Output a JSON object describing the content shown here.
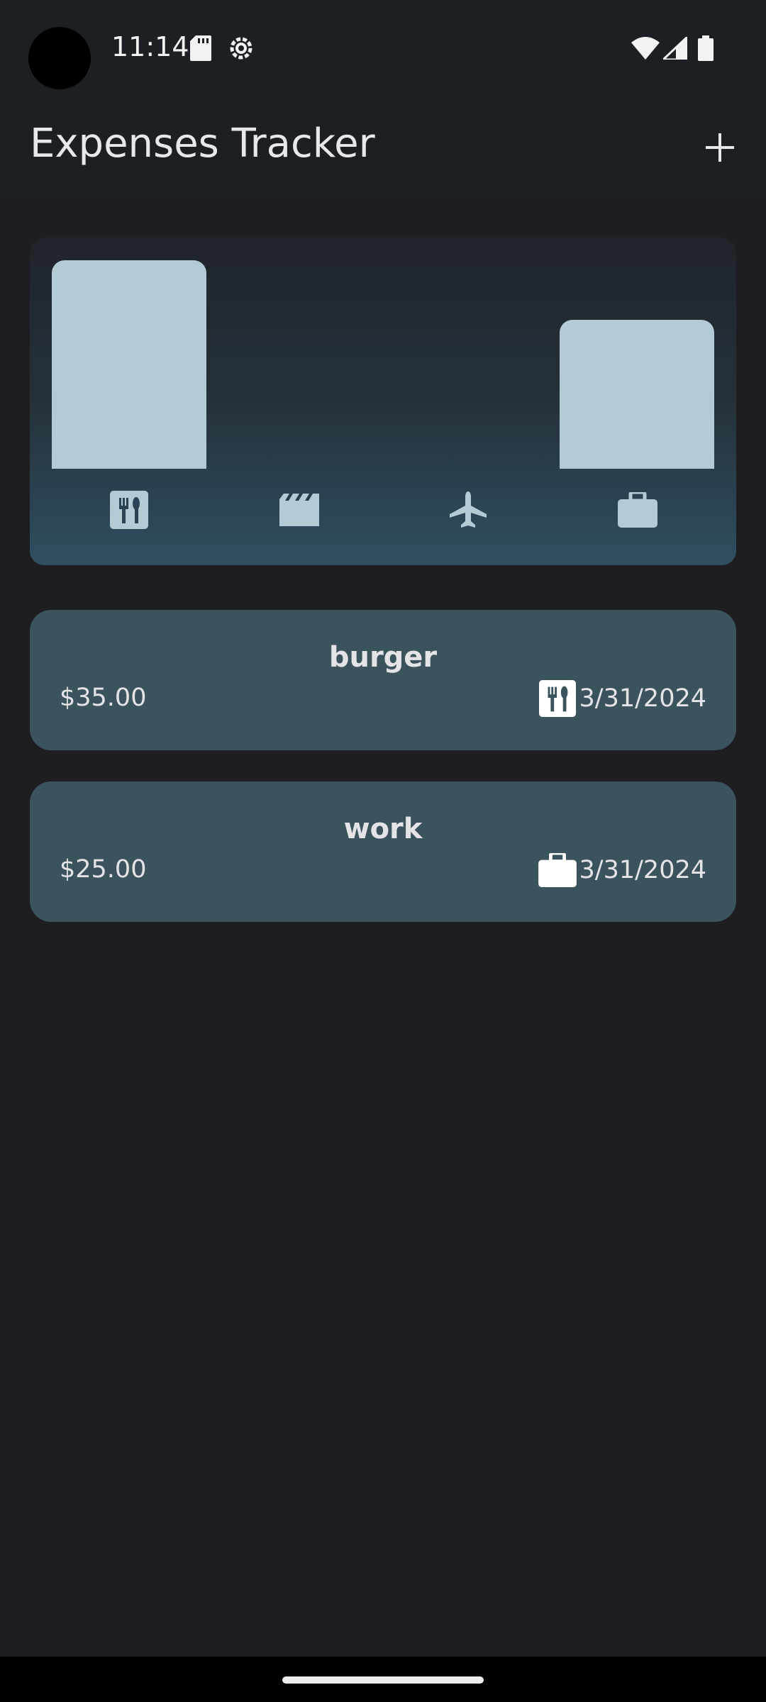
{
  "status_bar": {
    "time": "11:14",
    "icons": [
      "sd-card-icon",
      "sync-settings-icon",
      "wifi-icon",
      "cellular-signal-icon",
      "battery-icon"
    ]
  },
  "app_bar": {
    "title": "Expenses Tracker",
    "action_icon": "add-icon"
  },
  "colors": {
    "background": "#1e1e22",
    "bar": "#b4cad4",
    "card": "#3b535c",
    "icon_muted": "#b4cad4"
  },
  "chart_data": {
    "type": "bar",
    "categories": [
      "food",
      "leisure",
      "travel",
      "work"
    ],
    "category_icons": [
      "restaurant-icon",
      "movie-clapper-icon",
      "airplane-icon",
      "briefcase-icon"
    ],
    "values": [
      35,
      0,
      0,
      25
    ],
    "title": "",
    "xlabel": "",
    "ylabel": ""
  },
  "expenses": [
    {
      "title": "burger",
      "amount": "$35.00",
      "category_icon": "restaurant-icon",
      "date": "3/31/2024"
    },
    {
      "title": "work",
      "amount": "$25.00",
      "category_icon": "briefcase-icon",
      "date": "3/31/2024"
    }
  ]
}
